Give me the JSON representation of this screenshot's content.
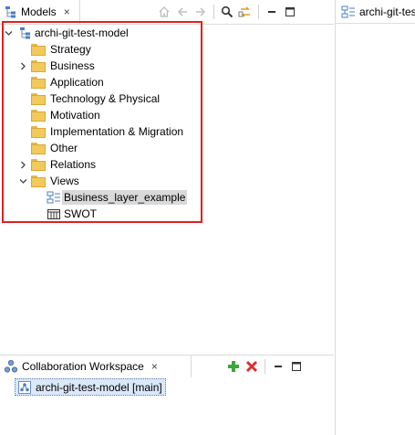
{
  "models_panel": {
    "tab_title": "Models",
    "tab_close": "×",
    "tree": {
      "root": "archi-git-test-model",
      "folders": [
        "Strategy",
        "Business",
        "Application",
        "Technology & Physical",
        "Motivation",
        "Implementation & Migration",
        "Other",
        "Relations",
        "Views"
      ],
      "views": [
        "Business_layer_example",
        "SWOT"
      ]
    }
  },
  "editor_tab": {
    "title": "archi-git-tes"
  },
  "collaboration_panel": {
    "tab_title": "Collaboration Workspace",
    "tab_close": "×",
    "item": "archi-git-test-model [main]"
  },
  "colors": {
    "highlight_border": "#e02020",
    "selection_bg": "#d9d9d9",
    "folder_yellow": "#f2ca5c",
    "add_green": "#3aa83a",
    "delete_red": "#d83030"
  }
}
